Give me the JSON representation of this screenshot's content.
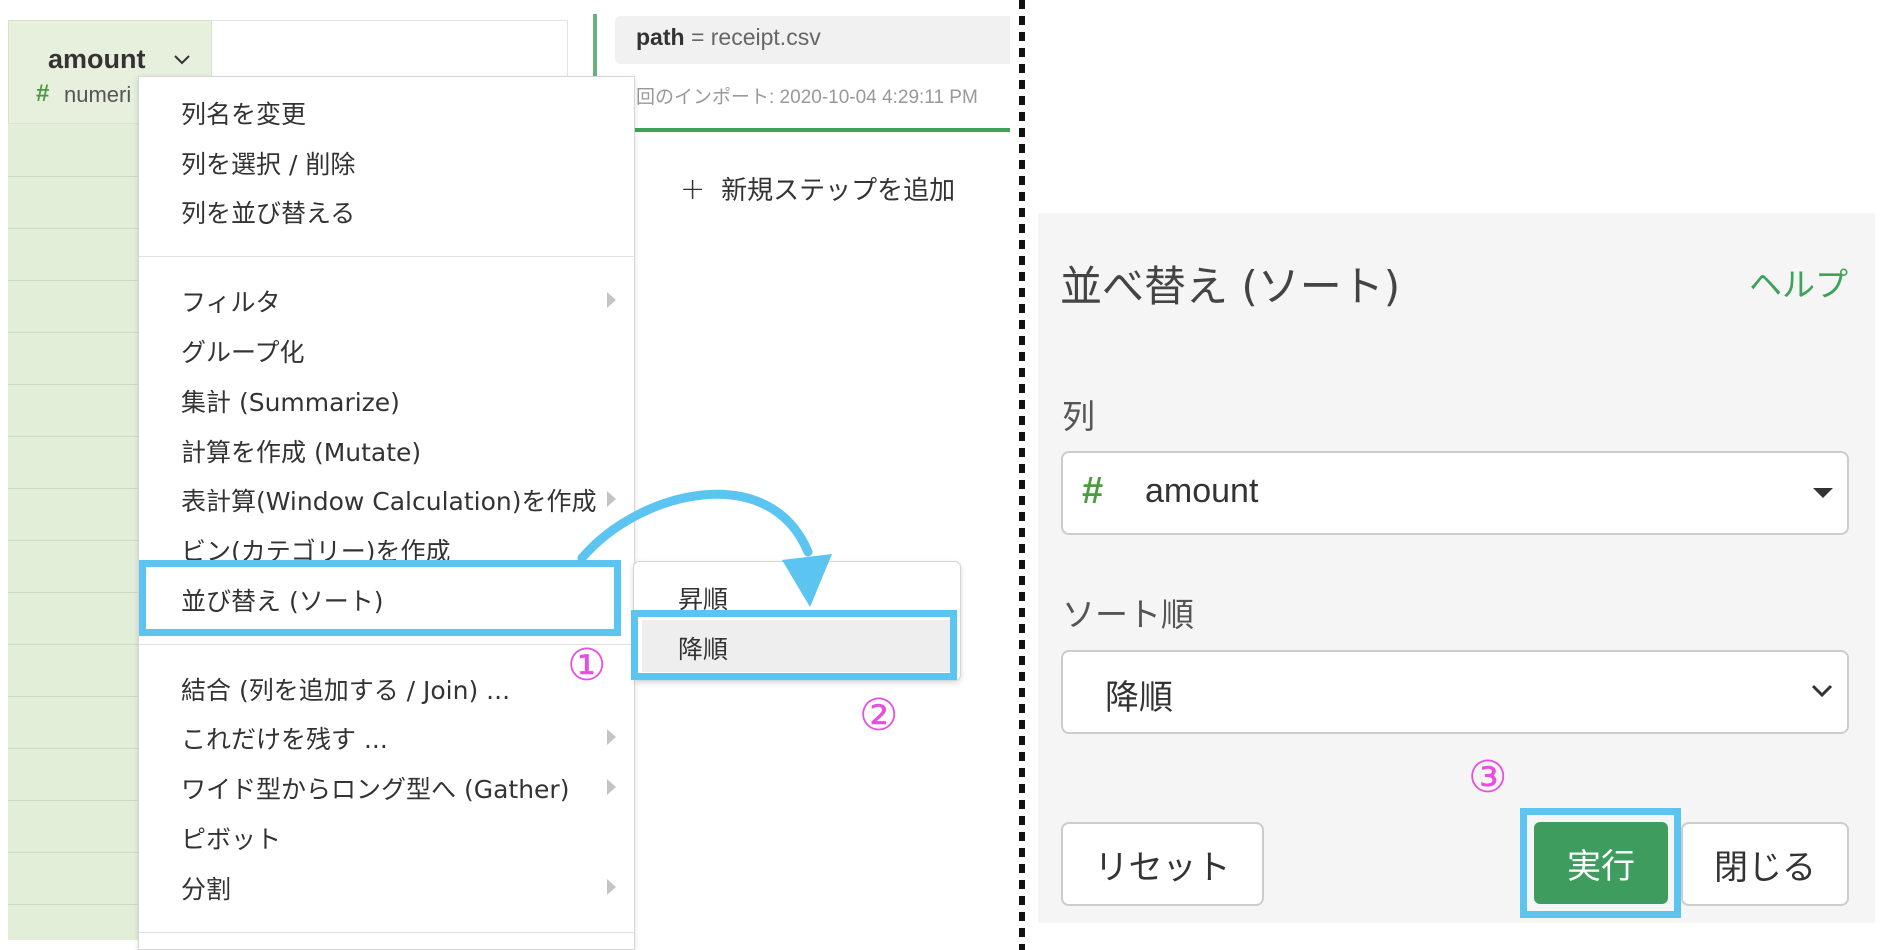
{
  "column": {
    "name": "amount",
    "type_icon": "#",
    "type_text": "numeri"
  },
  "step_panel": {
    "path_key": "path",
    "path_value": "= receipt.csv",
    "import_text": "回のインポート: 2020-10-04 4:29:11 PM",
    "add_step": "新規ステップを追加",
    "plus_glyph": "+"
  },
  "menu": {
    "group1": [
      "列名を変更",
      "列を選択 / 削除",
      "列を並び替える"
    ],
    "group2": [
      "フィルタ",
      "グループ化",
      "集計 (Summarize)",
      "計算を作成 (Mutate)",
      "表計算(Window Calculation)を作成",
      "ビン(カテゴリー)を作成",
      "並び替え (ソート)"
    ],
    "group3": [
      "結合 (列を追加する / Join) ...",
      "これだけを残す ...",
      "ワイド型からロング型へ (Gather)",
      "ピボット",
      "分割"
    ]
  },
  "submenu": {
    "asc": "昇順",
    "desc": "降順"
  },
  "annotations": {
    "step1": "①",
    "step2": "②",
    "step3": "③"
  },
  "dialog": {
    "title": "並べ替え (ソート)",
    "help": "ヘルプ",
    "column_label": "列",
    "column_icon": "#",
    "column_value": "amount",
    "order_label": "ソート順",
    "order_value": "降順",
    "reset": "リセット",
    "run": "実行",
    "close": "閉じる"
  },
  "colors": {
    "highlight": "#5bc4f0",
    "annotation": "#e64fe0",
    "accent_green": "#3e9c5e"
  }
}
